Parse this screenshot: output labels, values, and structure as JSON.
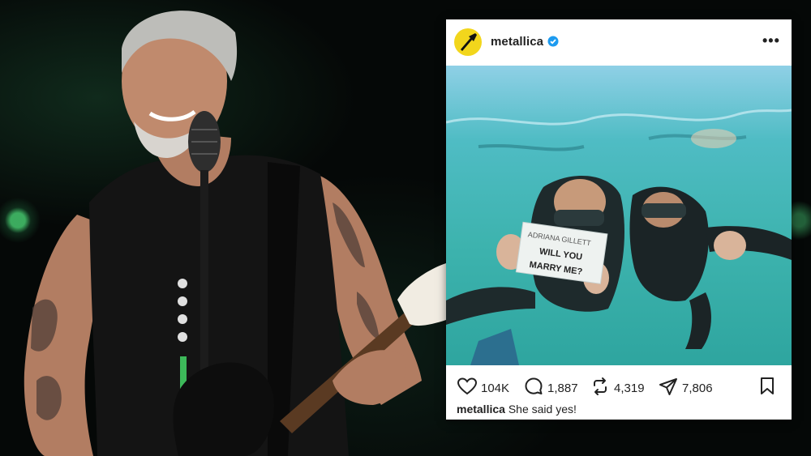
{
  "post": {
    "username": "metallica",
    "verified": true,
    "image_sign": {
      "line1": "ADRIANA GILLETT",
      "line2": "WILL YOU",
      "line3": "MARRY ME?"
    },
    "stats": {
      "likes": "104K",
      "comments": "1,887",
      "reposts": "4,319",
      "shares": "7,806"
    },
    "caption_user": "metallica",
    "caption_text": "She said yes!"
  },
  "icons": [
    "avatar-logo-icon",
    "verified-badge-icon",
    "more-options-icon",
    "heart-icon",
    "comment-icon",
    "repost-icon",
    "share-icon",
    "bookmark-icon"
  ],
  "colors": {
    "avatar_bg": "#f2d61c",
    "verified_blue": "#1d9bf0",
    "water": "#3fb8b6"
  }
}
